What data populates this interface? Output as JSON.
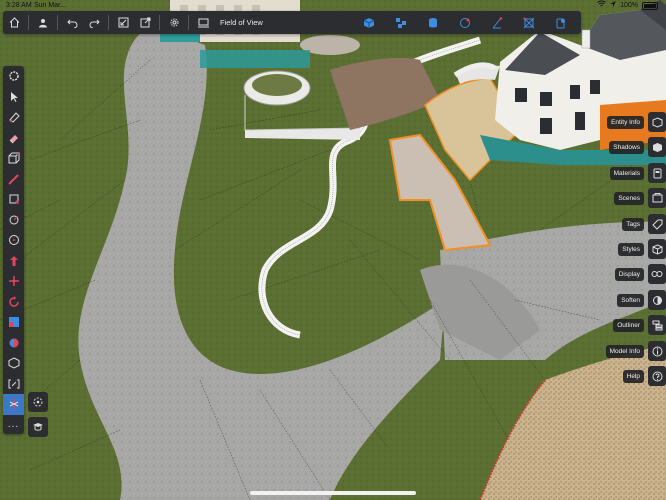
{
  "status": {
    "time": "3:28 AM",
    "carrier": "Sun Mar...",
    "battery": "100%"
  },
  "topbar": {
    "title": "Field of View",
    "buttons": [
      "home-icon",
      "user-icon",
      "undo-icon",
      "redo-icon",
      "import-icon",
      "export-icon",
      "settings-icon",
      "layout-icon"
    ],
    "right_tools": [
      "orbit-icon",
      "components-icon",
      "paint-icon",
      "warehouse-icon",
      "scenes-icon",
      "xray-icon",
      "section-icon",
      "perspective-icon"
    ]
  },
  "left_tools": [
    "select-icon",
    "arrow-icon",
    "lasso-icon",
    "eraser-icon",
    "box-icon",
    "pencil-icon",
    "paint-tool-icon",
    "tape-icon",
    "circle-icon",
    "pushpull-icon",
    "move-icon",
    "rotate-icon",
    "scale-icon",
    "eye-icon",
    "orbit-tool-icon",
    "walk-icon",
    "section-tool-icon"
  ],
  "more_label": "...",
  "panels": [
    {
      "label": "Entity Info",
      "icon": "entity-info-icon"
    },
    {
      "label": "Shadows",
      "icon": "shadows-icon"
    },
    {
      "label": "Materials",
      "icon": "materials-icon"
    },
    {
      "label": "Scenes",
      "icon": "scenes-panel-icon"
    },
    {
      "label": "Tags",
      "icon": "tags-icon"
    },
    {
      "label": "Styles",
      "icon": "styles-icon"
    },
    {
      "label": "Display",
      "icon": "display-icon"
    },
    {
      "label": "Soften",
      "icon": "soften-icon"
    },
    {
      "label": "Outliner",
      "icon": "outliner-icon"
    },
    {
      "label": "Model Info",
      "icon": "model-info-icon"
    },
    {
      "label": "Help",
      "icon": "help-icon"
    }
  ]
}
